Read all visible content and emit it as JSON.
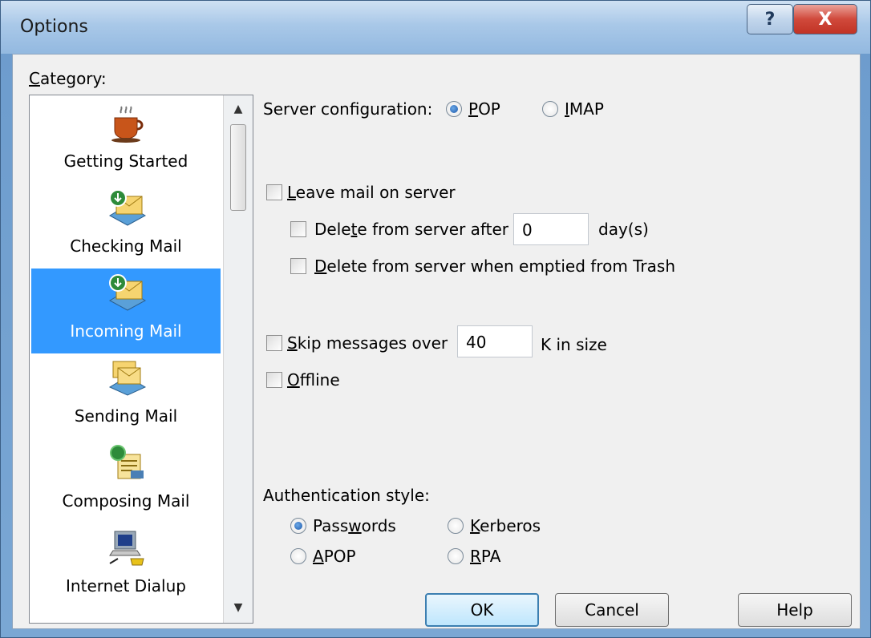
{
  "window": {
    "title": "Options",
    "help_glyph": "?",
    "close_glyph": "X"
  },
  "category": {
    "label": "Category:",
    "items": [
      {
        "label": "Getting Started",
        "icon": "coffee-cup-icon",
        "selected": false
      },
      {
        "label": "Checking Mail",
        "icon": "checking-mail-icon",
        "selected": false
      },
      {
        "label": "Incoming Mail",
        "icon": "incoming-mail-icon",
        "selected": true
      },
      {
        "label": "Sending Mail",
        "icon": "sending-mail-icon",
        "selected": false
      },
      {
        "label": "Composing Mail",
        "icon": "composing-mail-icon",
        "selected": false
      },
      {
        "label": "Internet Dialup",
        "icon": "internet-dialup-icon",
        "selected": false
      }
    ],
    "scroll_up": "▲",
    "scroll_down": "▼"
  },
  "server": {
    "label": "Server configuration:",
    "pop_label": "POP",
    "imap_label": "IMAP",
    "selected": "POP"
  },
  "leave_mail": {
    "label": "Leave mail on server",
    "checked": false,
    "delete_after_label": "Delete from server after",
    "delete_after_value": "0",
    "days_label": "day(s)",
    "delete_trash_label": "Delete from server when emptied from Trash"
  },
  "skip": {
    "label": "Skip messages over",
    "value": "40",
    "unit": "K in size"
  },
  "offline": {
    "label": "Offline",
    "checked": false
  },
  "auth": {
    "label": "Authentication style:",
    "passwords_label": "Passwords",
    "kerberos_label": "Kerberos",
    "apop_label": "APOP",
    "rpa_label": "RPA",
    "selected": "Passwords"
  },
  "buttons": {
    "ok": "OK",
    "cancel": "Cancel",
    "help": "Help"
  },
  "colors": {
    "selection": "#3399ff",
    "dialog_bg": "#f0f0f0",
    "title_close": "#c13325"
  }
}
